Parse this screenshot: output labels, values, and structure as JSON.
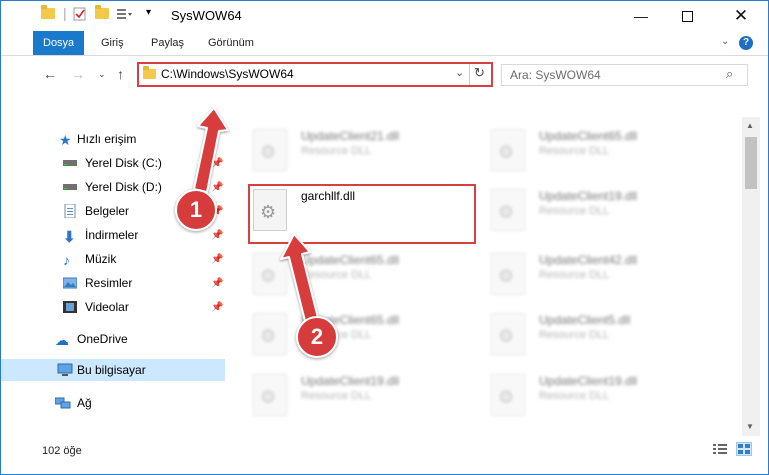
{
  "window": {
    "title": "SysWOW64"
  },
  "ribbon": {
    "tabs": [
      "Dosya",
      "Giriş",
      "Paylaş",
      "Görünüm"
    ],
    "help_label": "?"
  },
  "address": {
    "path": "C:\\Windows\\SysWOW64",
    "search_placeholder": "Ara: SysWOW64"
  },
  "sidebar": {
    "items": [
      {
        "label": "Hızlı erişim",
        "icon": "star-icon",
        "pinned": false
      },
      {
        "label": "Yerel Disk (C:)",
        "icon": "drive-icon",
        "pinned": true
      },
      {
        "label": "Yerel Disk (D:)",
        "icon": "drive-icon",
        "pinned": true
      },
      {
        "label": "Belgeler",
        "icon": "documents-icon",
        "pinned": true
      },
      {
        "label": "İndirmeler",
        "icon": "download-icon",
        "pinned": true
      },
      {
        "label": "Müzik",
        "icon": "music-icon",
        "pinned": true
      },
      {
        "label": "Resimler",
        "icon": "pictures-icon",
        "pinned": true
      },
      {
        "label": "Videolar",
        "icon": "video-icon",
        "pinned": true
      },
      {
        "label": "OneDrive",
        "icon": "cloud-icon",
        "pinned": false
      },
      {
        "label": "Bu bilgisayar",
        "icon": "computer-icon",
        "pinned": false
      },
      {
        "label": "Ağ",
        "icon": "network-icon",
        "pinned": false
      }
    ],
    "pin_glyph": "📌"
  },
  "files": [
    {
      "name": "UpdateClient21.dll",
      "type": "Resource DLL",
      "blurred": true
    },
    {
      "name": "UpdateClient65.dll",
      "type": "Resource DLL",
      "blurred": true
    },
    {
      "name": "garchllf.dll",
      "type": "",
      "blurred": false
    },
    {
      "name": "UpdateClient19.dll",
      "type": "Resource DLL",
      "blurred": true
    },
    {
      "name": "UpdateClient65.dll",
      "type": "Resource DLL",
      "blurred": true
    },
    {
      "name": "UpdateClient42.dll",
      "type": "Resource DLL",
      "blurred": true
    },
    {
      "name": "UpdateClient65.dll",
      "type": "Resource DLL",
      "blurred": true
    },
    {
      "name": "UpdateClient5.dll",
      "type": "Resource DLL",
      "blurred": true
    },
    {
      "name": "UpdateClient19.dll",
      "type": "Resource DLL",
      "blurred": true
    },
    {
      "name": "UpdateClient19.dll",
      "type": "Resource DLL",
      "blurred": true
    }
  ],
  "status": {
    "count": "102 öğe"
  },
  "annotations": {
    "badge1": "1",
    "badge2": "2",
    "color": "#d73c3c"
  }
}
